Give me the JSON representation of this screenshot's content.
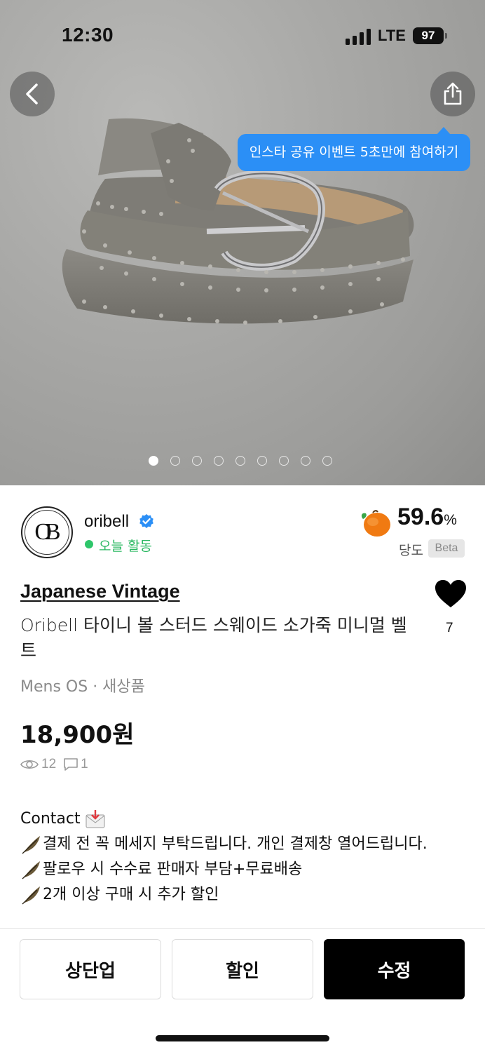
{
  "status_bar": {
    "time": "12:30",
    "network": "LTE",
    "battery": "97"
  },
  "hero": {
    "tooltip": "인스타 공유 이벤트 5초만에 참여하기",
    "page_indicator": {
      "total": 9,
      "current": 1
    },
    "icons": {
      "back": "chevron-left-icon",
      "share": "share-icon"
    }
  },
  "seller": {
    "avatar_text": "OB",
    "name": "oribell",
    "verified": true,
    "activity": "오늘 활동",
    "sweetness_score": "59.6",
    "sweetness_unit": "%",
    "sweetness_label": "당도",
    "beta_badge": "Beta"
  },
  "product": {
    "brand": "Japanese Vintage",
    "title": "Oribell 타이니 볼 스터드 스웨이드 소가죽 미니멀 벨트",
    "meta": "Mens OS · 새상품",
    "price": "18,900원",
    "likes": "7",
    "views": "12",
    "comments": "1"
  },
  "description": {
    "contact": "Contact",
    "lines": [
      "결제 전 꼭 메세지 부탁드립니다. 개인 결제창 열어드립니다.",
      "팔로우 시 수수료 판매자 부담+무료배송",
      "2개 이상 구매 시 추가 할인"
    ]
  },
  "actions": {
    "bump": "상단업",
    "discount": "할인",
    "edit": "수정"
  },
  "colors": {
    "accent_blue": "#2b8ff6",
    "active_green": "#2ec66a",
    "primary_button": "#000000"
  }
}
